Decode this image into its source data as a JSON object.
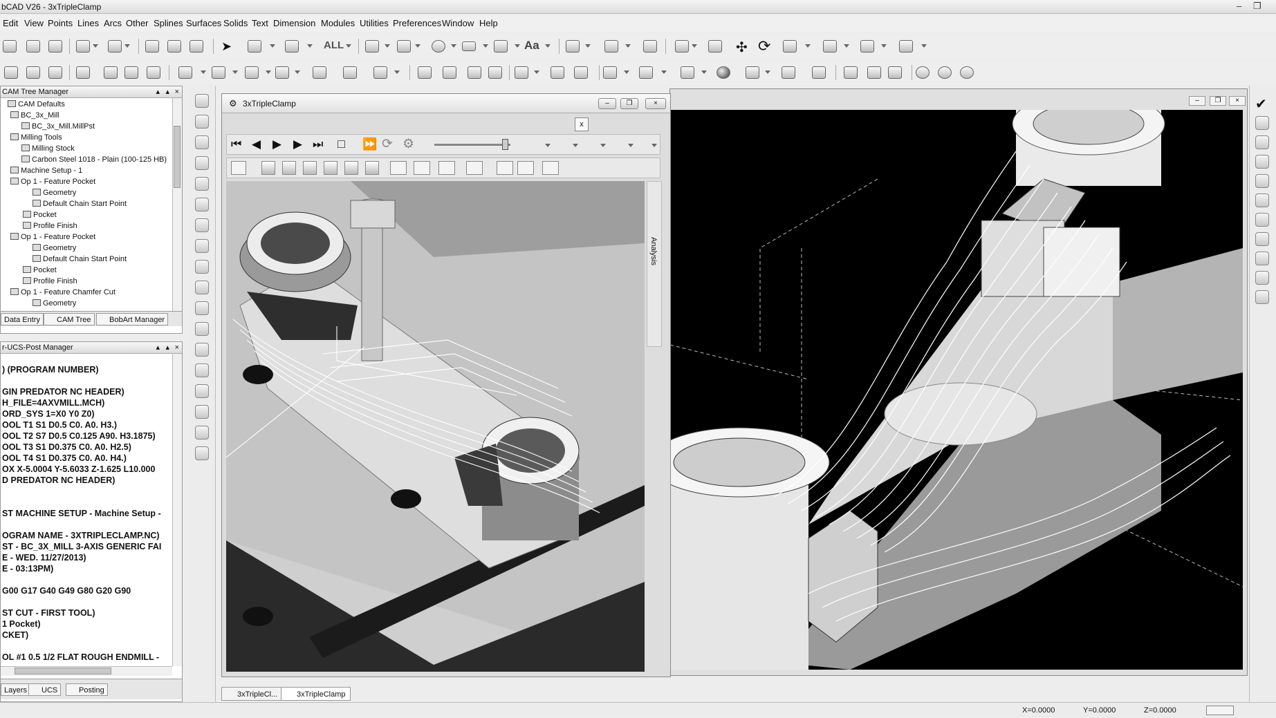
{
  "window": {
    "title": "bCAD V26 - 3xTripleClamp"
  },
  "menu": [
    "Edit",
    "View",
    "Points",
    "Lines",
    "Arcs",
    "Other",
    "Splines",
    "Surfaces",
    "Solids",
    "Text",
    "Dimension",
    "Modules",
    "Utilities",
    "Preferences",
    "Window",
    "Help"
  ],
  "toolbar": {
    "all_label": "ALL",
    "text_label": "Aa"
  },
  "cam_tree": {
    "title": "CAM Tree Manager",
    "items": [
      "CAM Defaults",
      "BC_3x_Mill",
      "BC_3x_Mill.MillPst",
      "Milling Tools",
      "Milling Stock",
      "Carbon Steel 1018 - Plain (100-125 HB)",
      "Machine Setup - 1",
      "Op 1 - Feature Pocket",
      "Geometry",
      "Default Chain Start Point",
      "Pocket",
      "Profile Finish",
      "Op 1 - Feature Pocket",
      "Geometry",
      "Default Chain Start Point",
      "Pocket",
      "Profile Finish",
      "Op 1 - Feature Chamfer Cut",
      "Geometry"
    ],
    "tabs": [
      "Data Entry",
      "CAM Tree",
      "BobArt Manager"
    ]
  },
  "post_manager": {
    "title": "r-UCS-Post Manager",
    "lines": [
      ") (PROGRAM NUMBER)",
      "",
      "GIN PREDATOR NC HEADER)",
      "H_FILE=4AXVMILL.MCH)",
      "ORD_SYS 1=X0 Y0 Z0)",
      "OOL T1 S1 D0.5 C0. A0. H3.)",
      "OOL T2 S7 D0.5 C0.125 A90. H3.1875)",
      "OOL T3 S1 D0.375 C0. A0. H2.5)",
      "OOL T4 S1 D0.375 C0. A0. H4.)",
      "OX X-5.0004 Y-5.6033 Z-1.625 L10.000",
      "D PREDATOR NC HEADER)",
      "",
      "",
      "ST MACHINE SETUP - Machine Setup -",
      "",
      "OGRAM NAME - 3XTRIPLECLAMP.NC)",
      "ST -  BC_3X_MILL 3-AXIS GENERIC FAI",
      "E - WED. 11/27/2013)",
      "E - 03:13PM)",
      "",
      "G00 G17 G40 G49 G80 G20 G90",
      "",
      "ST CUT - FIRST TOOL)",
      "1  Pocket)",
      "CKET)",
      "",
      "OL #1 0.5  1/2 FLAT ROUGH ENDMILL -"
    ],
    "tabs": [
      "Layers",
      "UCS",
      "Posting"
    ]
  },
  "left_view": {
    "title": "3xTripleClamp",
    "close_label": "x",
    "analysis_label": "Analysis"
  },
  "bottom_tabs": [
    "3xTripleCl...",
    "3xTripleClamp"
  ],
  "status": {
    "x": "X=0.0000",
    "y": "Y=0.0000",
    "z": "Z=0.0000"
  }
}
